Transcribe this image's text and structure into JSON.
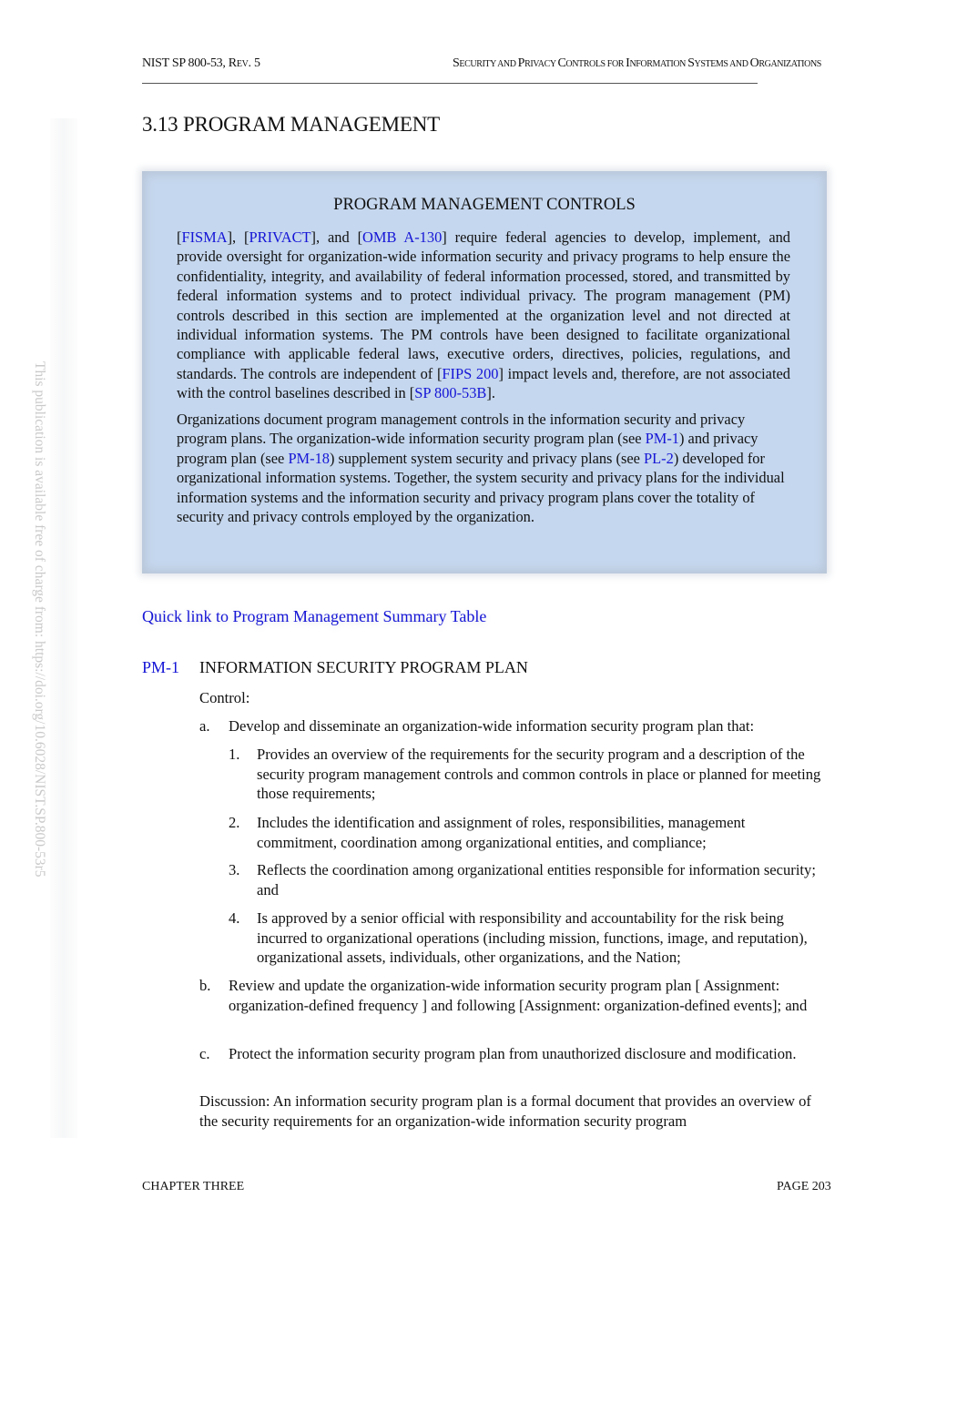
{
  "header": {
    "doc_id": "NIST SP 800-53, Rev. 5",
    "doc_id_main": "NIST SP 800-53, R",
    "doc_id_sc": "EV",
    "doc_id_tail": ". 5",
    "running_title": "Security and Privacy Controls for Information Systems and Organizations",
    "running_title_parts": [
      {
        "cap": "S",
        "sc": "ECURITY AND "
      },
      {
        "cap": "P",
        "sc": "RIVACY "
      },
      {
        "cap": "C",
        "sc": "ONTROLS FOR "
      },
      {
        "cap": "I",
        "sc": "NFORMATION "
      },
      {
        "cap": "S",
        "sc": "YSTEMS AND "
      },
      {
        "cap": "O",
        "sc": "RGANIZATIONS"
      }
    ]
  },
  "side_note": "This publication is available free of charge from: https://doi.org/10.6028/NIST.SP.800-53r5",
  "section": {
    "number": "3.13",
    "title": "PROGRAM MANAGEMENT",
    "full": "3.13  PROGRAM MANAGEMENT"
  },
  "intro_box": {
    "title": "PROGRAM MANAGEMENT CONTROLS",
    "p1": {
      "refs": [
        "FISMA",
        "PRIVACT",
        "OMB A-130",
        "FIPS 200",
        "SP 800-53B"
      ],
      "t0": "[",
      "t1": "], [",
      "t2": "], and [",
      "t3": "] require federal agencies to develop, implement, and provide oversight for organization-wide information security and privacy programs to help ensure the confidentiality, integrity, and availability of federal information processed, stored, and transmitted by federal information systems and to protect individual privacy. The program management (PM) controls described in this section are implemented at the organization level and not directed at individual information systems. The PM controls have been designed to facilitate organizational compliance with applicable federal laws, executive orders, directives, policies, regulations, and standards. The controls are independent of [",
      "t4": "] impact levels and, therefore, are not associated with the control baselines described in [",
      "t5": "]."
    },
    "p2": {
      "refs": [
        "PM-1",
        "PM-18",
        "PL-2"
      ],
      "t0": "Organizations document program management controls in the information security and privacy program plans. The organization-wide information security program plan (see ",
      "t1": ") and privacy program plan (see ",
      "t2": ") supplement system security and privacy plans (see ",
      "t3": ") developed for organizational information systems. Together, the system security and privacy plans for the individual information systems and the information security and privacy program plans cover the totality of security and privacy controls employed by the organization."
    }
  },
  "quick_link": "Quick link to Program Management Summary Table",
  "control": {
    "id": "PM-1",
    "title": "INFORMATION SECURITY PROGRAM PLAN",
    "label": "Control:",
    "items": [
      {
        "mark": "a.",
        "text": "Develop and disseminate an organization-wide information security program plan that:",
        "subitems": [
          {
            "mark": "1.",
            "text": "Provides an overview of the requirements for the security program and a description of the security program management controls and common controls in place or planned for meeting those requirements;"
          },
          {
            "mark": "2.",
            "text": "Includes the identification and assignment of roles, responsibilities, management commitment, coordination among organizational entities, and compliance;"
          },
          {
            "mark": "3.",
            "text": "Reflects the coordination among organizational entities responsible for information security; and"
          },
          {
            "mark": "4.",
            "text": "Is approved by a senior official with responsibility and accountability for the risk being incurred to organizational operations (including mission, functions, image, and reputation), organizational assets, individuals, other organizations, and the Nation;"
          }
        ]
      },
      {
        "mark": "b.",
        "text": "Review and update the organization-wide information security program plan [ Assignment: organization-defined frequency ] and following [Assignment: organization-defined events]; and"
      },
      {
        "mark": "c.",
        "text": "Protect the information security program plan from unauthorized disclosure and modification."
      }
    ],
    "discussion": "Discussion: An information security program plan is a formal document that provides an overview of the security requirements for an organization-wide information security program"
  },
  "footer": {
    "chapter": "CHAPTER THREE",
    "page": "PAGE 203"
  },
  "colors": {
    "link": "#1515d6",
    "box_background": "#c5d7ee",
    "watermark_text": "#c9c9c9"
  }
}
